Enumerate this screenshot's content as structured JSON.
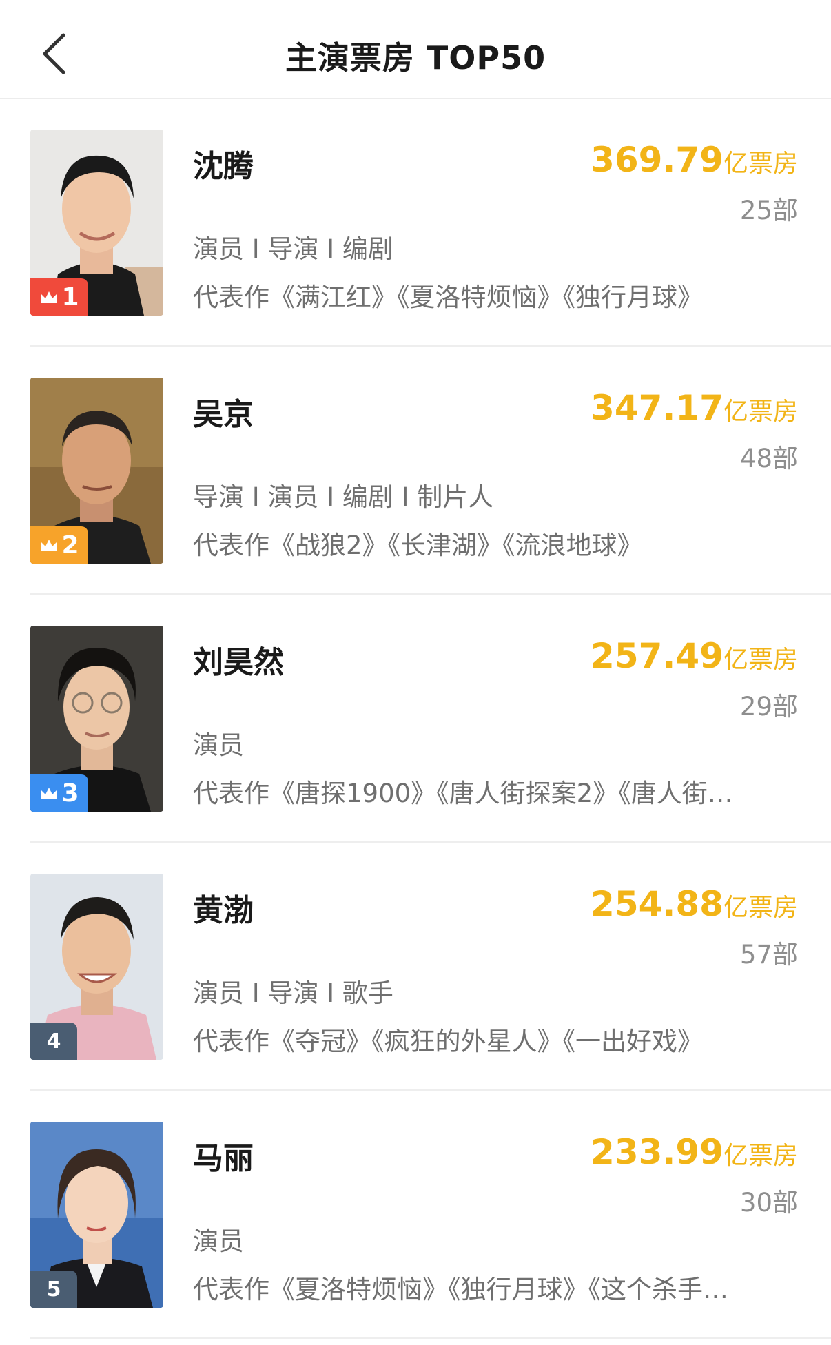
{
  "header": {
    "title": "主演票房 TOP50",
    "back_icon": "chevron-left-icon"
  },
  "colors": {
    "accent": "#f2b417",
    "rank1": "#f04a3b",
    "rank2": "#f7a32a",
    "rank3": "#3a8ef0",
    "rank_plain": "#4a5d72"
  },
  "actors": [
    {
      "rank": "1",
      "name": "沈腾",
      "box_value": "369.79",
      "box_unit": "亿票房",
      "count": "25部",
      "roles": "演员 I 导演 I 编剧",
      "works": "代表作《满江红》《夏洛特烦恼》《独行月球》"
    },
    {
      "rank": "2",
      "name": "吴京",
      "box_value": "347.17",
      "box_unit": "亿票房",
      "count": "48部",
      "roles": "导演 I 演员 I 编剧 I 制片人",
      "works": "代表作《战狼2》《长津湖》《流浪地球》"
    },
    {
      "rank": "3",
      "name": "刘昊然",
      "box_value": "257.49",
      "box_unit": "亿票房",
      "count": "29部",
      "roles": "演员",
      "works": "代表作《唐探1900》《唐人街探案2》《唐人街…"
    },
    {
      "rank": "4",
      "name": "黄渤",
      "box_value": "254.88",
      "box_unit": "亿票房",
      "count": "57部",
      "roles": "演员 I 导演 I 歌手",
      "works": "代表作《夺冠》《疯狂的外星人》《一出好戏》"
    },
    {
      "rank": "5",
      "name": "马丽",
      "box_value": "233.99",
      "box_unit": "亿票房",
      "count": "30部",
      "roles": "演员",
      "works": "代表作《夏洛特烦恼》《独行月球》《这个杀手…"
    }
  ]
}
